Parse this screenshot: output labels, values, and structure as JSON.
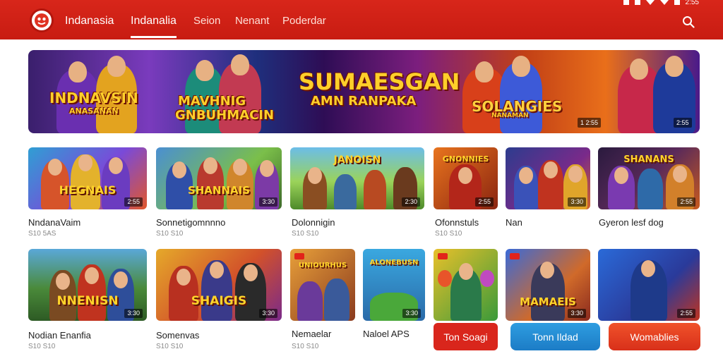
{
  "header": {
    "nav": [
      "Indanasia",
      "Indanalia",
      "Seion",
      "Nenant",
      "Poderdar"
    ],
    "status_time": "2:55"
  },
  "banner": {
    "text_left": "INDNAVSIN",
    "text_left_sub": "ANASANAN",
    "text_mid": "MAVHNIG",
    "text_mid_sub": "GNBUHMACIN",
    "headline": "SUMAESGAN",
    "headline_sub": "AMN RANPAKA",
    "text_right": "SOLANGIES",
    "text_right_sub": "NANAMAN",
    "badge_1": "1 2:55",
    "badge_2": "2:55"
  },
  "row1": [
    {
      "art": "HEGNAIS",
      "badge": "2:55",
      "label": "NndanaVaim",
      "sub": "S10 5AS"
    },
    {
      "art": "SHANNAIS",
      "badge": "3:30",
      "label": "Sonnetigomnnno",
      "sub": "S10 S10"
    },
    {
      "art": "JANOISN",
      "badge": "2:30",
      "label": "Dolonnigin",
      "sub": "S10 S10"
    },
    {
      "art": "GNONNIES",
      "badge": "2:55",
      "label": "Ofonnstuls",
      "sub": "S10 S10"
    },
    {
      "art": "",
      "badge": "3:30",
      "label": "Nan",
      "sub": ""
    },
    {
      "art": "SHANANS",
      "badge": "2:55",
      "label": "Gyeron lesf dog",
      "sub": ""
    }
  ],
  "row2": [
    {
      "art": "NNENISN",
      "badge": "3:30",
      "label": "Nodian Enanfia",
      "sub": "S10 S10"
    },
    {
      "art": "SHAIGIS",
      "badge": "3:30",
      "label": "Somenvas",
      "sub": "S10 S10"
    },
    {
      "art": "UNIOURHUS",
      "badge": "",
      "label": "Nemaelar",
      "sub": "S10 S10"
    },
    {
      "art": "ALONEBUSN",
      "badge": "3:30",
      "label": "Naloel APS",
      "sub": ""
    },
    {
      "art": "",
      "badge": "",
      "label": "",
      "sub": ""
    },
    {
      "art": "MAMAEIS",
      "badge": "3:30",
      "label": "",
      "sub": ""
    },
    {
      "art": "",
      "badge": "2:55",
      "label": "",
      "sub": ""
    }
  ],
  "buttons": [
    "Ton Soagi",
    "Tonn Ildad",
    "Womablies"
  ]
}
